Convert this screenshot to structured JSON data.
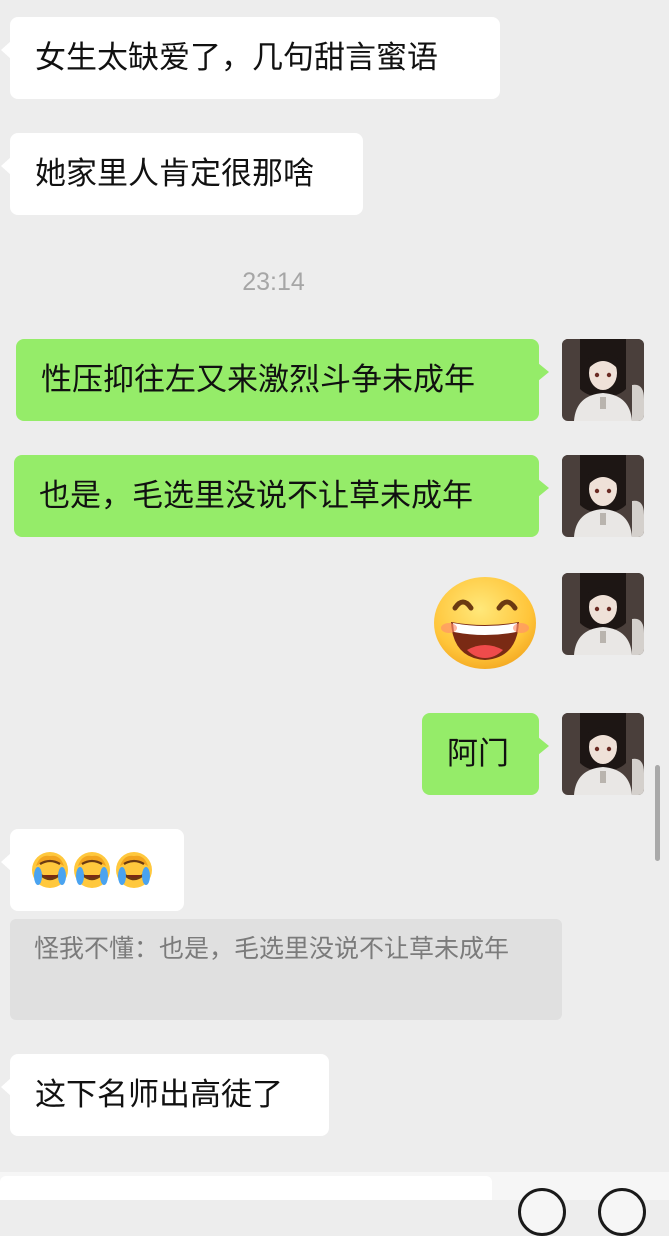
{
  "messages": [
    {
      "side": "left",
      "text": "女生太缺爱了，几句甜言蜜语"
    },
    {
      "side": "left",
      "text": "她家里人肯定很那啥"
    },
    {
      "side": "right",
      "text": "性压抑往左又来激烈斗争未成年"
    },
    {
      "side": "right",
      "text": "也是，毛选里没说不让草未成年"
    },
    {
      "side": "right",
      "text": "阿门"
    },
    {
      "side": "left",
      "text": "这下名师出高徒了"
    }
  ],
  "timestamp": "23:14",
  "quote": {
    "text": "怪我不懂：也是，毛选里没说不让草未成年"
  },
  "icons": {
    "big_emoji": "grinning-face-emoji",
    "facepalm": "face-palm-emoji",
    "avatar": "user-avatar",
    "voice": "voice-icon",
    "emoji_btn": "emoji-button",
    "more_btn": "plus-button"
  },
  "colors": {
    "background": "#ededed",
    "incoming_bubble": "#ffffff",
    "outgoing_bubble": "#95ec69",
    "timestamp": "#a6a6a6",
    "quote_bg": "#e0e0e0",
    "quote_text": "#7b7b7b"
  }
}
